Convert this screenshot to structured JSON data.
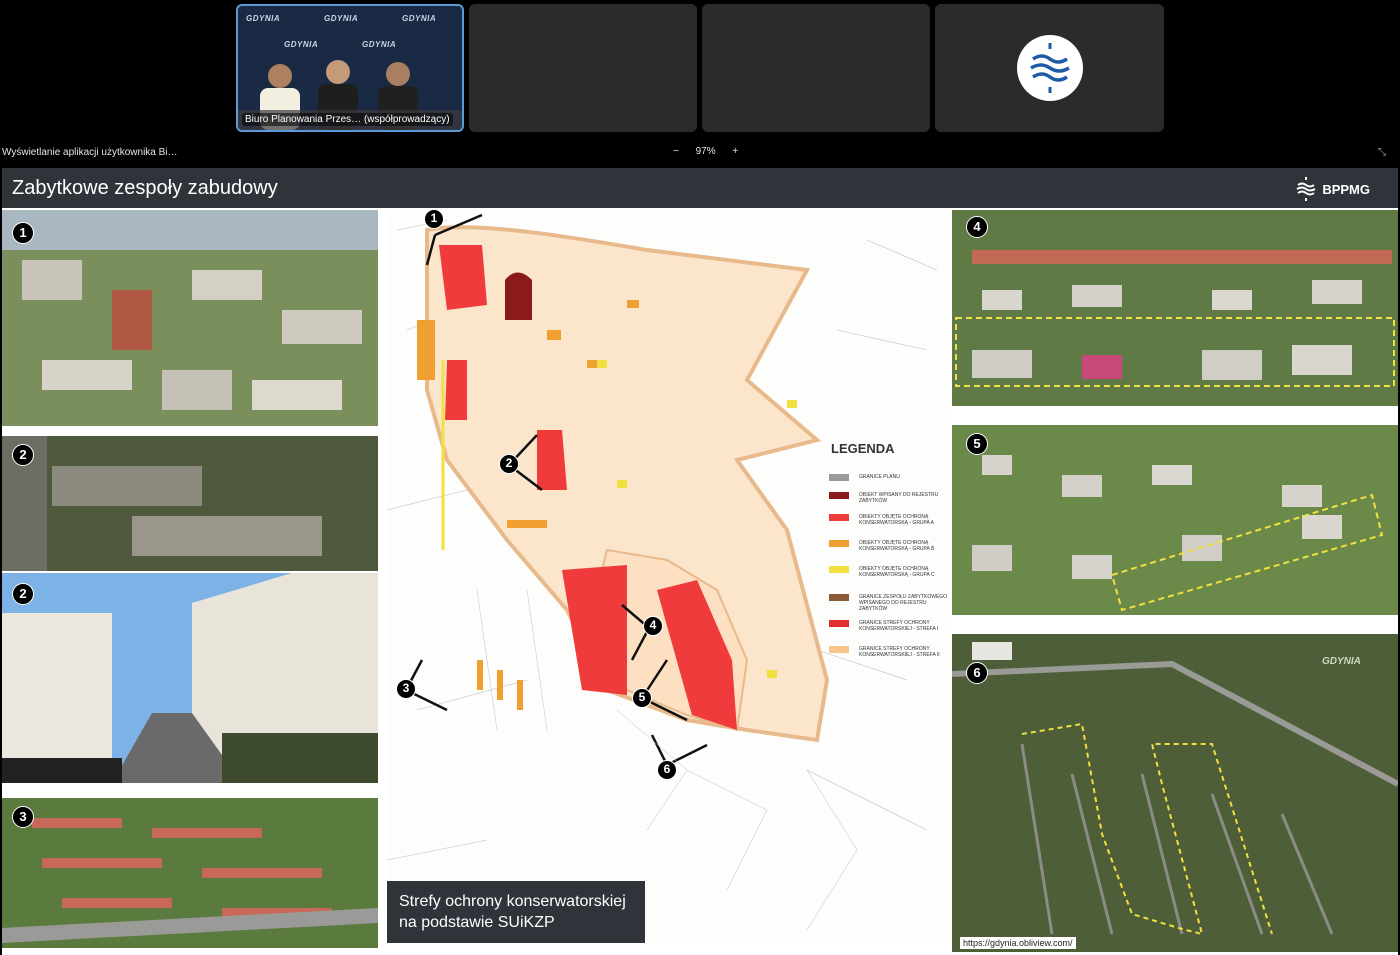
{
  "participants": [
    {
      "name": "Biuro Planowania Przes… (współprowadzący)",
      "backdrop_text": "GDYNIA",
      "active": true
    },
    {
      "name": ""
    },
    {
      "name": ""
    },
    {
      "name": "",
      "avatar": "bppmg-logo-icon"
    }
  ],
  "share": {
    "title": "Wyświetlanie aplikacji użytkownika Bi…",
    "zoom_out": "−",
    "zoom_level": "97%",
    "zoom_in": "+"
  },
  "slide": {
    "title": "Zabytkowe zespoły zabudowy",
    "brand": "BPPMG",
    "photos_left": [
      {
        "badge": "1"
      },
      {
        "badge": "2"
      },
      {
        "badge": "2"
      },
      {
        "badge": "3"
      }
    ],
    "photos_right": [
      {
        "badge": "4"
      },
      {
        "badge": "5"
      },
      {
        "badge": "6",
        "watermark": "GDYNIA"
      }
    ],
    "map": {
      "legend_title": "LEGENDA",
      "legend": [
        {
          "label": "GRANICE PLANU",
          "color": "#9a9a9a"
        },
        {
          "label": "OBIEKT WPISANY DO REJESTRU ZABYTKÓW",
          "color": "#8b1a1a"
        },
        {
          "label": "OBIEKTY OBJĘTE OCHRONĄ KONSERWATORSKĄ - GRUPA A",
          "color": "#ef3b3b"
        },
        {
          "label": "OBIEKTY OBJĘTE OCHRONĄ KONSERWATORSKĄ - GRUPA B",
          "color": "#f0a030"
        },
        {
          "label": "OBIEKTY OBJĘTE OCHRONĄ KONSERWATORSKĄ - GRUPA C",
          "color": "#f0e040"
        },
        {
          "label": "GRANICE ZESPOŁU ZABYTKOWEGO WPISANEGO DO REJESTRU ZABYTKÓW",
          "color": "#8a5a3a"
        },
        {
          "label": "GRANICE STREFY OCHRONY KONSERWATORSKIEJ - STREFA I",
          "color": "#e03030"
        },
        {
          "label": "GRANICE STREFY OCHRONY KONSERWATORSKIEJ - STREFA II",
          "color": "#f5c58a"
        }
      ],
      "view_markers": [
        "1",
        "2",
        "3",
        "4",
        "5",
        "6"
      ],
      "caption_line1": "Strefy ochrony konserwatorskiej",
      "caption_line2": "na podstawie SUiKZP"
    },
    "credit": "https://gdynia.obliview.com/"
  },
  "colors": {
    "header_bg": "#2f343a",
    "zone2_fill": "#fbe6cc",
    "zone_border": "#e8b98a",
    "zone1": "#ef3b3b",
    "group_b": "#f0a030",
    "group_c": "#f0e040",
    "register": "#8b1a1a"
  }
}
